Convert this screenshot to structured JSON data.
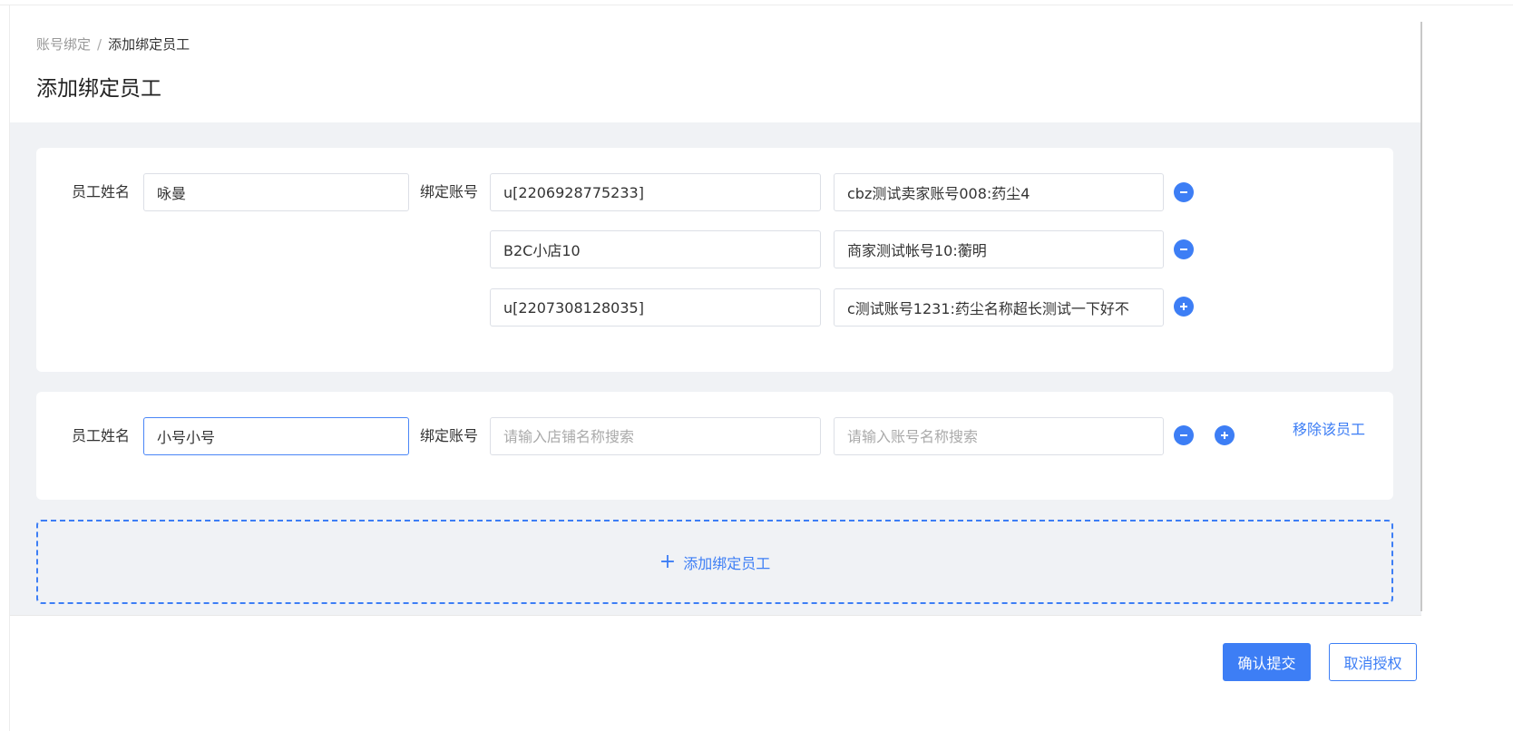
{
  "breadcrumb": {
    "parent": "账号绑定",
    "separator": "/",
    "current": "添加绑定员工"
  },
  "page_title": "添加绑定员工",
  "employees": [
    {
      "name_label": "员工姓名",
      "name_value": "咏曼",
      "bind_label": "绑定账号",
      "rows": [
        {
          "shop": "u[2206928775233]",
          "account": "cbz测试卖家账号008:药尘4"
        },
        {
          "shop": "B2C小店10",
          "account": "商家测试帐号10:蘅明"
        },
        {
          "shop": "u[2207308128035]",
          "account": "c测试账号1231:药尘名称超长测试一下好不"
        }
      ]
    },
    {
      "name_label": "员工姓名",
      "name_value": "小号小号",
      "bind_label": "绑定账号",
      "shop_placeholder": "请输入店铺名称搜索",
      "account_placeholder": "请输入账号名称搜索",
      "remove_label": "移除该员工"
    }
  ],
  "add_employee": {
    "plus": "+",
    "label": "添加绑定员工"
  },
  "footer": {
    "submit_label": "确认提交",
    "cancel_label": "取消授权"
  },
  "colors": {
    "accent": "#3d7ef5",
    "content_bg": "#f0f2f5"
  },
  "icons": {
    "remove": "minus-circle-icon",
    "add": "plus-circle-icon"
  }
}
